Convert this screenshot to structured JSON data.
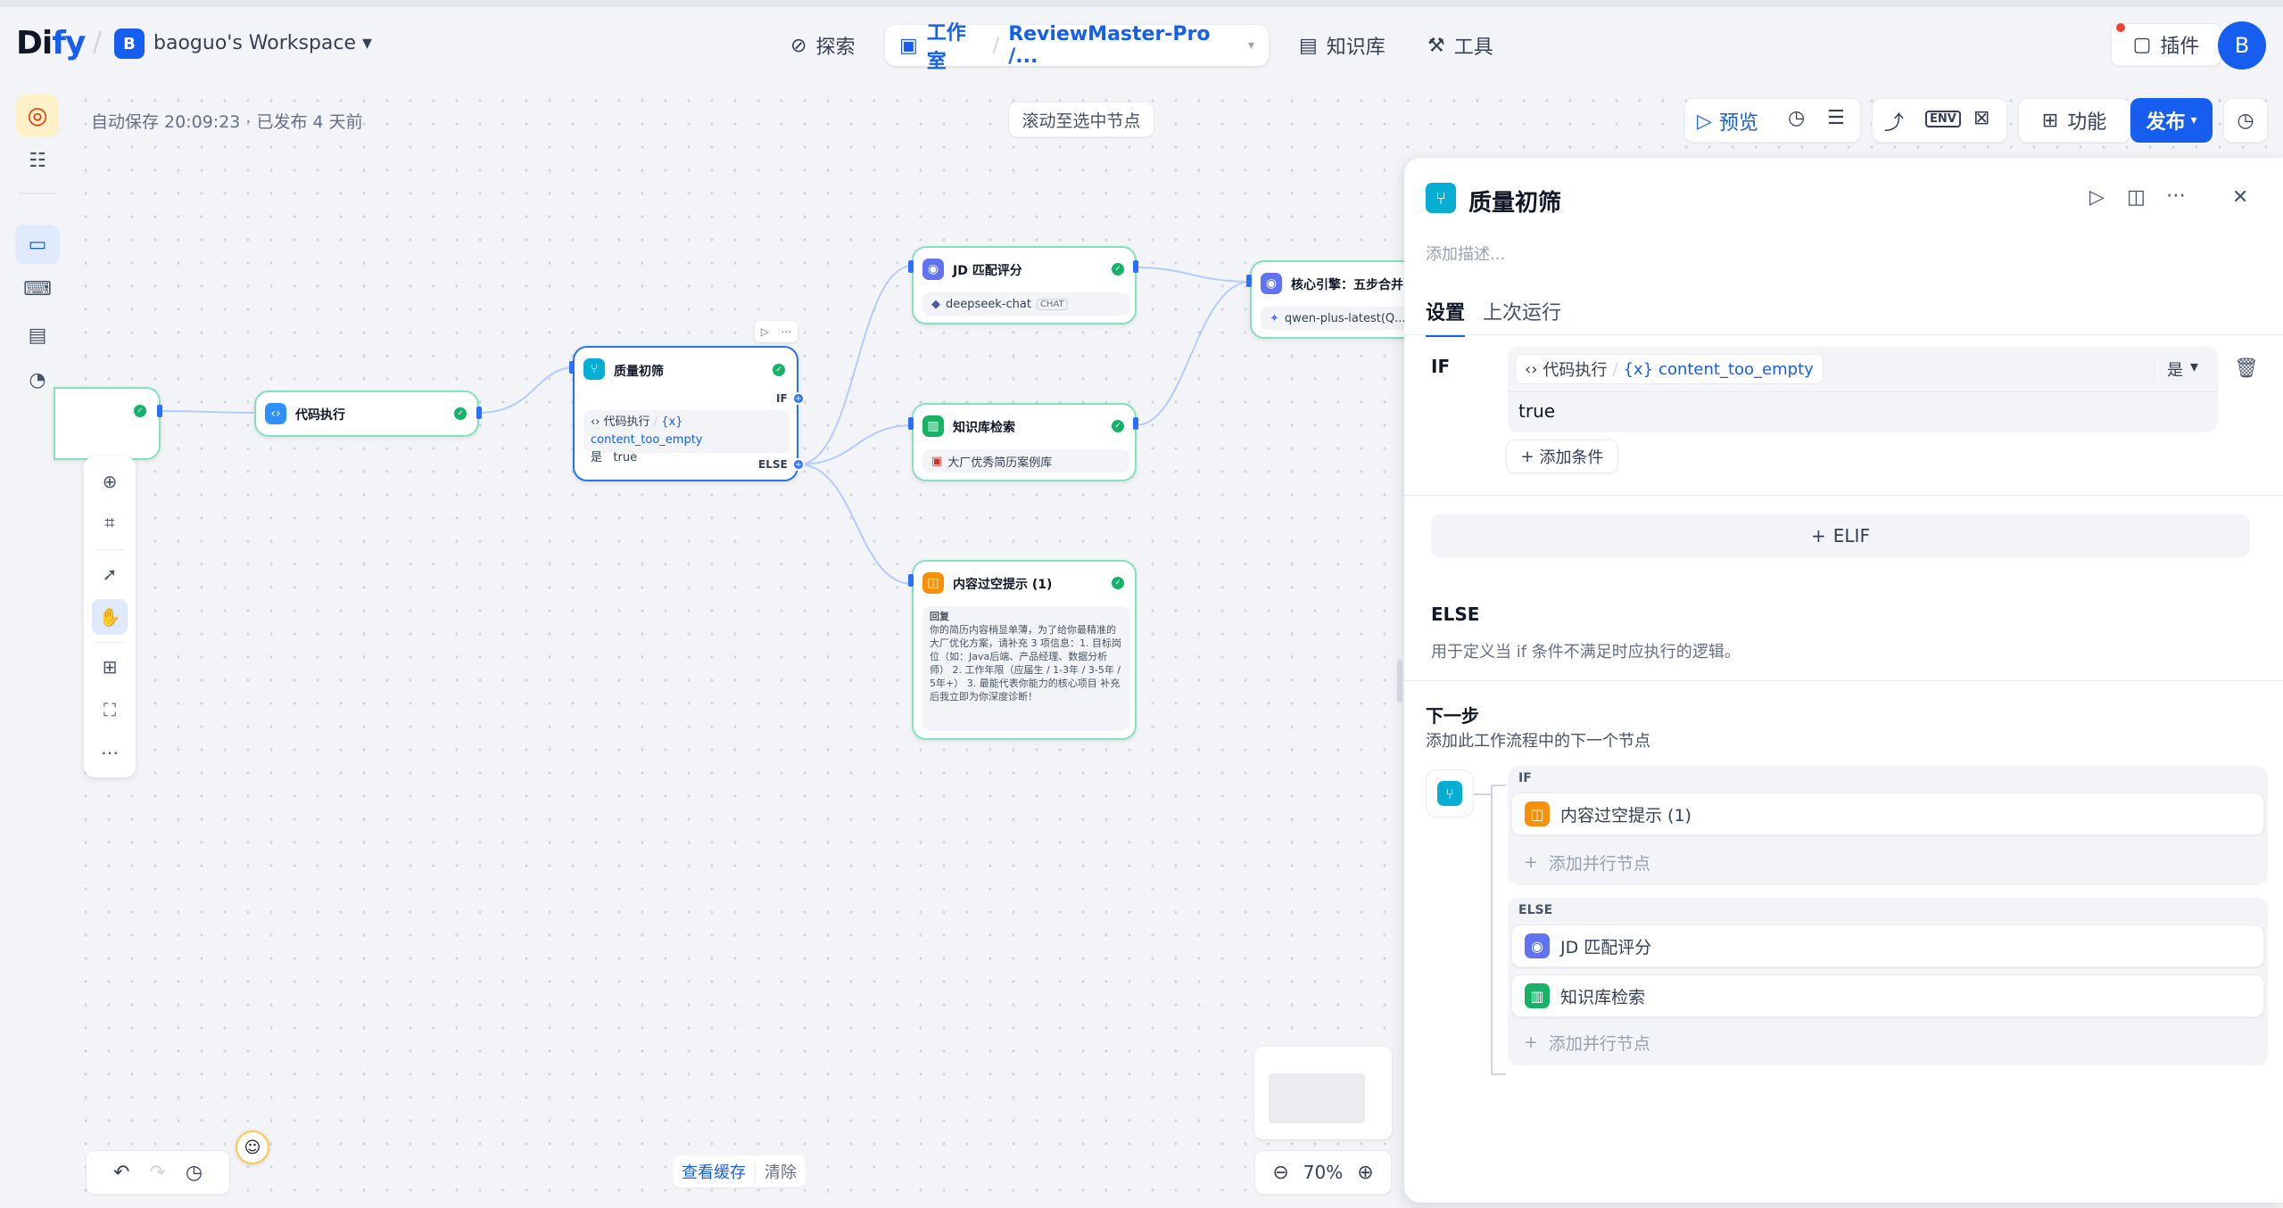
{
  "app": {
    "logo_prefix": "Di",
    "logo_suffix": "fy",
    "workspace_initial": "B",
    "workspace_name": "baoguo's Workspace"
  },
  "nav": {
    "explore": "探索",
    "studio": "工作室",
    "app_name": "ReviewMaster-Pro /...",
    "knowledge": "知识库",
    "tools": "工具",
    "plugins": "插件",
    "avatar": "B"
  },
  "status": {
    "autosave": "自动保存 20:09:23 · 已发布 4 天前",
    "scroll_to_node": "滚动至选中节点"
  },
  "toolbar": {
    "preview": "预览",
    "env": "ENV",
    "features": "功能",
    "publish": "发布"
  },
  "nodes": {
    "code": {
      "title": "代码执行"
    },
    "quality": {
      "title": "质量初筛",
      "if_label": "IF",
      "else_label": "ELSE",
      "var_source": "代码执行",
      "var_name": "content_too_empty",
      "op": "是",
      "value": "true"
    },
    "jd": {
      "title": "JD 匹配评分",
      "model": "deepseek-chat",
      "model_tag": "CHAT"
    },
    "kb": {
      "title": "知识库检索",
      "dataset": "大厂优秀简历案例库"
    },
    "core": {
      "title": "核心引擎：五步合并",
      "model": "qwen-plus-latest(Q..."
    },
    "empty": {
      "title": "内容过空提示 (1)",
      "label": "回复",
      "text": "你的简历内容稍显单薄，为了给你最精准的大厂优化方案，请补充 3 项信息：1. 目标岗位（如：Java后端、产品经理、数据分析师） 2. 工作年限（应届生 / 1-3年 / 3-5年 / 5年+） 3. 最能代表你能力的核心项目 补充后我立即为你深度诊断！"
    }
  },
  "canvas_bottom": {
    "view_cache": "查看缓存",
    "clear": "清除",
    "zoom": "70%"
  },
  "panel": {
    "title": "质量初筛",
    "desc_placeholder": "添加描述...",
    "tab_settings": "设置",
    "tab_last_run": "上次运行",
    "if_label": "IF",
    "cond_source": "代码执行",
    "cond_var": "content_too_empty",
    "cond_op": "是",
    "cond_value": "true",
    "add_condition": "添加条件",
    "elif": "ELIF",
    "else_title": "ELSE",
    "else_desc": "用于定义当 if 条件不满足时应执行的逻辑。",
    "next_title": "下一步",
    "next_desc": "添加此工作流程中的下一个节点",
    "branch_if": "IF",
    "branch_else": "ELSE",
    "if_targets": [
      "内容过空提示 (1)"
    ],
    "else_targets": [
      "JD 匹配评分",
      "知识库检索"
    ],
    "add_parallel": "添加并行节点"
  }
}
